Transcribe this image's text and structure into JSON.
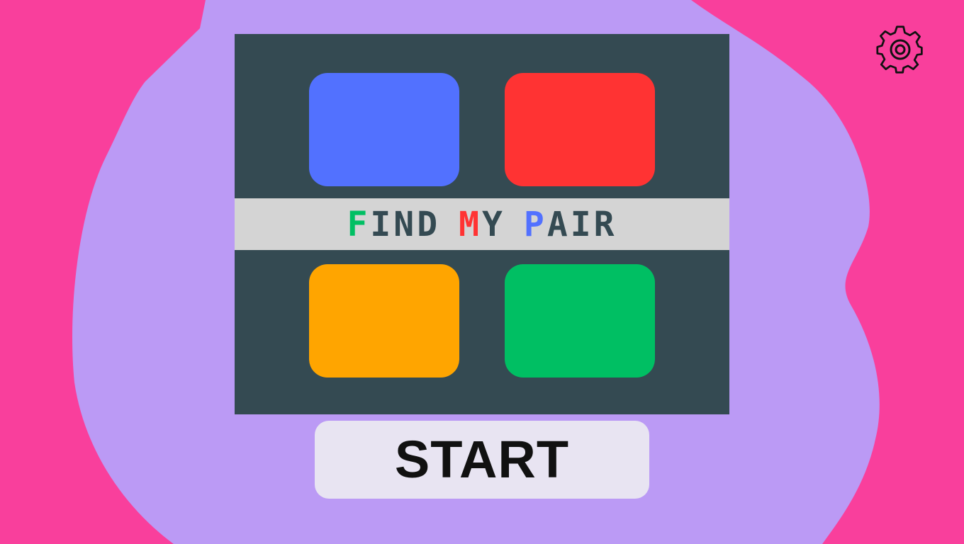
{
  "colors": {
    "background": "#f93f9c",
    "blob": "#bb9af5",
    "panel": "#344a52",
    "title_band": "#d4d4d4",
    "title_text": "#344a52",
    "tile_blue": "#5271ff",
    "tile_red": "#ff3333",
    "tile_orange": "#ffa500",
    "tile_green": "#00bf63",
    "start_button": "#e8e4f2"
  },
  "logo": {
    "title": {
      "word1": {
        "first": "F",
        "rest": "IND",
        "first_color": "#00bf63"
      },
      "word2": {
        "first": "M",
        "rest": "Y",
        "first_color": "#ff3333"
      },
      "word3": {
        "first": "P",
        "rest": "AIR",
        "first_color": "#5271ff"
      }
    },
    "tiles": [
      "blue",
      "red",
      "orange",
      "green"
    ]
  },
  "start_button": {
    "label": "START"
  },
  "settings": {
    "icon": "gear-icon"
  }
}
